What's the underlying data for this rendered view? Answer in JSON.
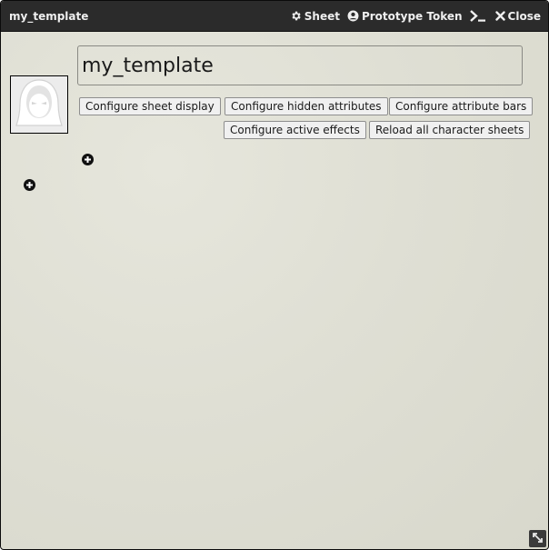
{
  "window": {
    "title": "my_template",
    "header_buttons": {
      "sheet": "Sheet",
      "prototype_token": "Prototype Token",
      "close": "Close"
    }
  },
  "sheet": {
    "name_value": "my_template",
    "buttons": {
      "configure_sheet_display": "Configure sheet display",
      "configure_hidden_attributes": "Configure hidden attributes",
      "configure_attribute_bars": "Configure attribute bars",
      "configure_active_effects": "Configure active effects",
      "reload_all_character_sheets": "Reload all character sheets"
    }
  },
  "icons": {
    "sheet": "gear-icon",
    "prototype_token": "user-circle-icon",
    "terminal": "terminal-icon",
    "close": "close-icon",
    "portrait": "hooded-figure-icon",
    "add": "plus-circle-icon",
    "resize": "resize-icon"
  },
  "colors": {
    "titlebar": "#2b2b2b",
    "titlebar_text": "#efefef",
    "parchment": "#dfdfd4",
    "button_bg": "#f0f0f0"
  }
}
